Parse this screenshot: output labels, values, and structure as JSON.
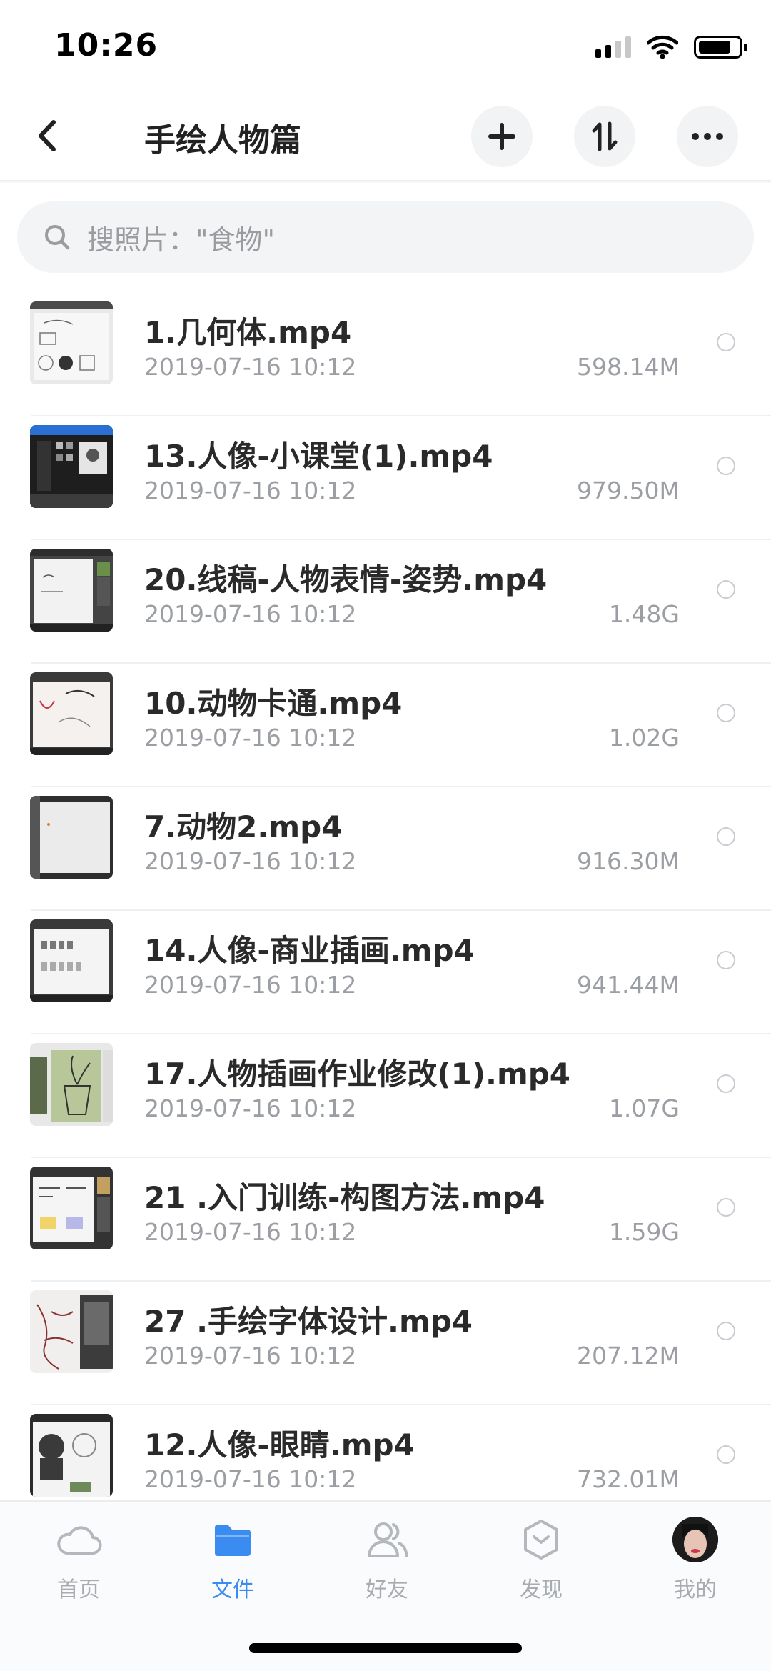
{
  "status_bar": {
    "time": "10:26"
  },
  "nav": {
    "title": "手绘人物篇"
  },
  "search": {
    "placeholder": "搜照片：\"食物\""
  },
  "files": [
    {
      "name": "1.几何体.mp4",
      "date": "2019-07-16 10:12",
      "size": "598.14M"
    },
    {
      "name": "13.人像-小课堂(1).mp4",
      "date": "2019-07-16 10:12",
      "size": "979.50M"
    },
    {
      "name": "20.线稿-人物表情-姿势.mp4",
      "date": "2019-07-16 10:12",
      "size": "1.48G"
    },
    {
      "name": "10.动物卡通.mp4",
      "date": "2019-07-16 10:12",
      "size": "1.02G"
    },
    {
      "name": "7.动物2.mp4",
      "date": "2019-07-16 10:12",
      "size": "916.30M"
    },
    {
      "name": "14.人像-商业插画.mp4",
      "date": "2019-07-16 10:12",
      "size": "941.44M"
    },
    {
      "name": "17.人物插画作业修改(1).mp4",
      "date": "2019-07-16 10:12",
      "size": "1.07G"
    },
    {
      "name": "21 .入门训练-构图方法.mp4",
      "date": "2019-07-16 10:12",
      "size": "1.59G"
    },
    {
      "name": "27 .手绘字体设计.mp4",
      "date": "2019-07-16 10:12",
      "size": "207.12M"
    },
    {
      "name": "12.人像-眼睛.mp4",
      "date": "2019-07-16 10:12",
      "size": "732.01M"
    }
  ],
  "tabs": [
    {
      "label": "首页",
      "icon": "cloud-icon"
    },
    {
      "label": "文件",
      "icon": "folder-icon",
      "active": true
    },
    {
      "label": "好友",
      "icon": "friends-icon"
    },
    {
      "label": "发现",
      "icon": "discover-icon"
    },
    {
      "label": "我的",
      "icon": "avatar"
    }
  ],
  "colors": {
    "accent": "#3b8cf0",
    "text_secondary": "#9b9ea3",
    "search_bg": "#f3f4f6"
  }
}
